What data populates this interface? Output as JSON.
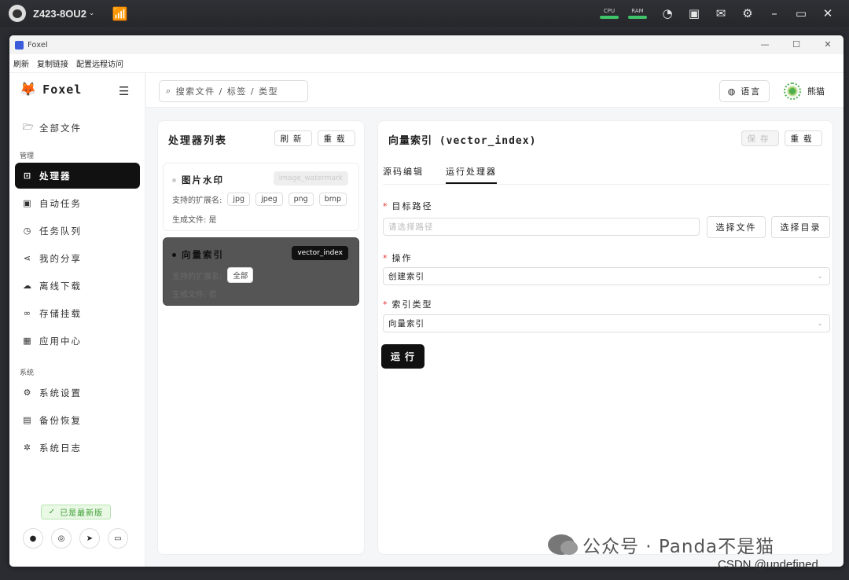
{
  "host": {
    "name": "Z423-8OU2",
    "cpu_label": "CPU",
    "ram_label": "RAM"
  },
  "window": {
    "title": "Foxel"
  },
  "menu": [
    "刷新",
    "复制链接",
    "配置远程访问"
  ],
  "sidebar": {
    "app_name": "Foxel",
    "top_item": "全部文件",
    "section_manage": "管理",
    "manage_items": [
      "处理器",
      "自动任务",
      "任务队列",
      "我的分享",
      "离线下载",
      "存储挂载",
      "应用中心"
    ],
    "section_system": "系统",
    "system_items": [
      "系统设置",
      "备份恢复",
      "系统日志"
    ],
    "version_badge": "已是最新版"
  },
  "topbar": {
    "search_placeholder": "搜索文件 / 标签 / 类型",
    "language": "语言",
    "username": "熊猫"
  },
  "processor_list": {
    "title": "处理器列表",
    "refresh": "刷新",
    "reload": "重载",
    "cards": [
      {
        "name": "图片水印",
        "tag": "image_watermark",
        "ext_label": "支持的扩展名:",
        "exts": [
          "jpg",
          "jpeg",
          "png",
          "bmp"
        ],
        "gen_label": "生成文件: 是"
      },
      {
        "name": "向量索引",
        "tag": "vector_index",
        "ext_label": "支持的扩展名:",
        "exts": [
          "全部"
        ],
        "gen_label": "生成文件: 否"
      }
    ]
  },
  "detail": {
    "title": "向量索引 (vector_index)",
    "save": "保存",
    "reload": "重载",
    "tabs": [
      "源码编辑",
      "运行处理器"
    ],
    "target_label": "目标路径",
    "target_placeholder": "请选择路径",
    "choose_file": "选择文件",
    "choose_dir": "选择目录",
    "op_label": "操作",
    "op_value": "创建索引",
    "index_type_label": "索引类型",
    "index_type_value": "向量索引",
    "run": "运行"
  },
  "watermark": {
    "text": "公众号 · Panda不是猫",
    "csdn": "CSDN @undefined"
  }
}
